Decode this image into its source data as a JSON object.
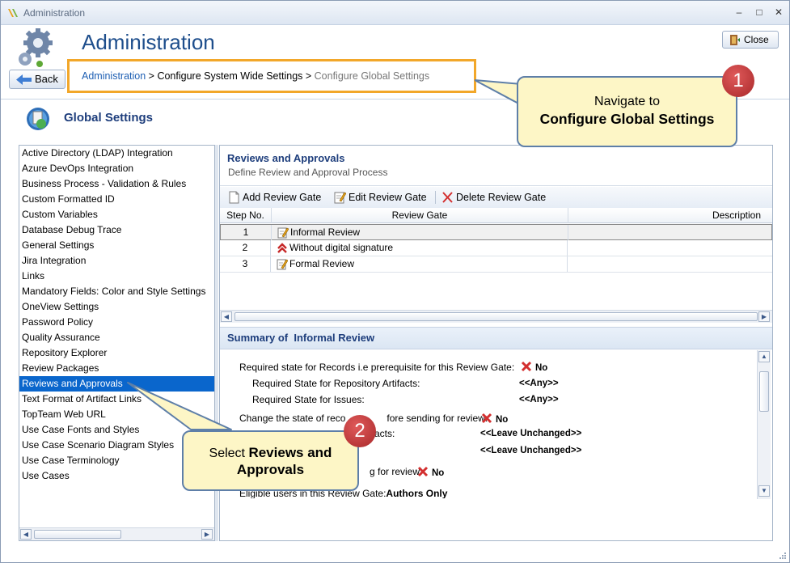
{
  "window": {
    "title": "Administration",
    "controls": {
      "minimize": "–",
      "maximize": "□",
      "close": "✕"
    }
  },
  "header": {
    "page_title": "Administration",
    "close_label": "Close",
    "back_label": "Back"
  },
  "breadcrumb": {
    "root": "Administration",
    "sep1": " > ",
    "middle": "Configure System Wide Settings",
    "sep2": " > ",
    "current": "Configure Global Settings"
  },
  "section": {
    "title": "Global Settings"
  },
  "sidebar": {
    "items": [
      {
        "label": "Active Directory (LDAP) Integration"
      },
      {
        "label": "Azure DevOps Integration"
      },
      {
        "label": "Business Process - Validation & Rules"
      },
      {
        "label": "Custom Formatted ID"
      },
      {
        "label": "Custom Variables"
      },
      {
        "label": "Database Debug Trace"
      },
      {
        "label": "General Settings"
      },
      {
        "label": "Jira Integration"
      },
      {
        "label": "Links"
      },
      {
        "label": "Mandatory Fields: Color and Style Settings"
      },
      {
        "label": "OneView Settings"
      },
      {
        "label": "Password Policy"
      },
      {
        "label": "Quality Assurance"
      },
      {
        "label": "Repository Explorer"
      },
      {
        "label": "Review Packages"
      },
      {
        "label": "Reviews and Approvals",
        "selected": true
      },
      {
        "label": "Text Format of Artifact Links"
      },
      {
        "label": "TopTeam Web URL"
      },
      {
        "label": "Use Case Fonts and Styles"
      },
      {
        "label": "Use Case Scenario Diagram Styles"
      },
      {
        "label": "Use Case Terminology"
      },
      {
        "label": "Use Cases"
      }
    ]
  },
  "main": {
    "title": "Reviews and Approvals",
    "subtitle": "Define Review and Approval Process",
    "toolbar": {
      "add": "Add Review Gate",
      "edit": "Edit Review Gate",
      "delete": "Delete Review Gate"
    },
    "grid": {
      "columns": [
        "Step No.",
        "Review Gate",
        "Description"
      ],
      "rows": [
        {
          "step": "1",
          "gate": "Informal Review",
          "icon": "edit-doc-icon"
        },
        {
          "step": "2",
          "gate": "Without digital signature",
          "icon": "double-chevron-up-icon"
        },
        {
          "step": "3",
          "gate": "Formal Review",
          "icon": "edit-doc-icon"
        }
      ]
    },
    "summary": {
      "prefix": "Summary of",
      "name": "Informal Review",
      "line1_label": "Required state for Records i.e prerequisite for this Review Gate:",
      "line1_value": "No",
      "line2_label": "Required State for Repository Artifacts:",
      "line2_value": "<<Any>>",
      "line3_label": "Required State for Issues:",
      "line3_value": "<<Any>>",
      "line4_label": "Change the state of reco",
      "line4_label_tail": "fore sending for review:",
      "line4_value": "No",
      "line5_label_tail": "ifacts:",
      "line5_value": "<<Leave Unchanged>>",
      "line6_value": "<<Leave Unchanged>>",
      "line7_label_tail": "g for review:",
      "line7_value": "No",
      "line8_label": "Eligible users in this Review Gate:",
      "line8_value": "Authors Only"
    }
  },
  "callouts": {
    "one": {
      "num": "1",
      "line1": "Navigate to",
      "line2": "Configure Global Settings"
    },
    "two": {
      "num": "2",
      "pre": "Select ",
      "bold1": "Reviews and",
      "bold2": "Approvals"
    }
  },
  "colors": {
    "accent": "#1e4e8c",
    "selection": "#0a66cc",
    "breadcrumb_border": "#f2a72a",
    "callout_bg": "#fdf6c6",
    "callout_badge": "#b33030"
  }
}
